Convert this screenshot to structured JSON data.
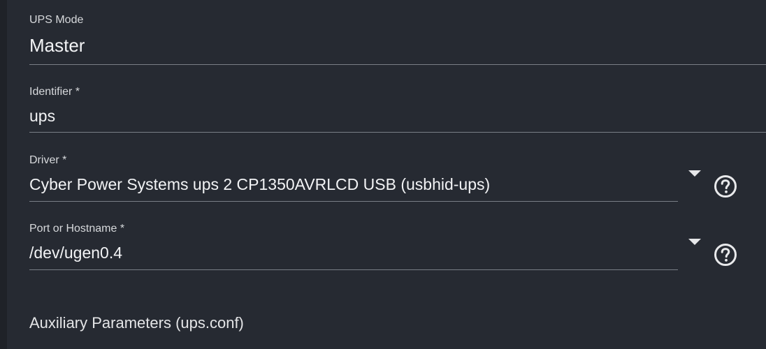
{
  "form": {
    "ups_mode": {
      "label": "UPS Mode",
      "value": "Master"
    },
    "identifier": {
      "label": "Identifier *",
      "value": "ups"
    },
    "driver": {
      "label": "Driver *",
      "value": "Cyber Power Systems ups 2 CP1350AVRLCD USB (usbhid-ups)"
    },
    "port": {
      "label": "Port or Hostname *",
      "value": "/dev/ugen0.4"
    },
    "auxiliary_section": {
      "title": "Auxiliary Parameters (ups.conf)"
    }
  },
  "icons": {
    "dropdown": "chevron-down-icon",
    "help": "help-circle-icon"
  },
  "colors": {
    "background": "#262a32",
    "underline": "#7a7f87",
    "text": "#f2f3f5"
  }
}
